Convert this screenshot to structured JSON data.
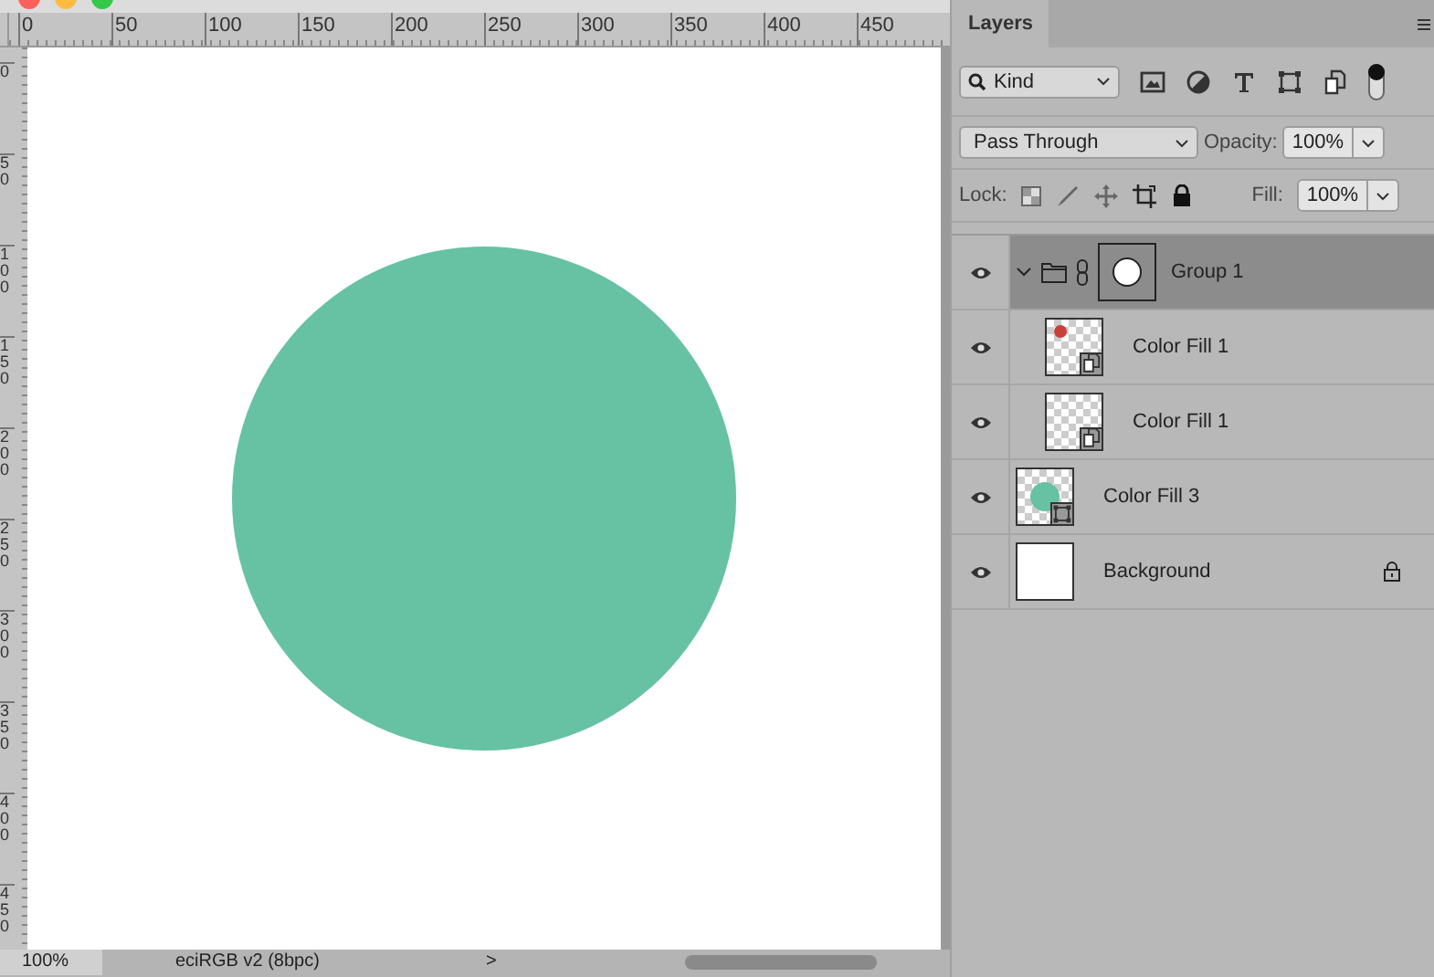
{
  "rulers": {
    "horizontal": [
      "0",
      "50",
      "100",
      "150",
      "200",
      "250",
      "300",
      "350",
      "400",
      "450"
    ],
    "vertical": [
      "0",
      "50",
      "100",
      "150",
      "200",
      "250",
      "300",
      "350",
      "400",
      "450"
    ]
  },
  "canvas": {
    "color": "#66c2a2"
  },
  "status_bar": {
    "zoom": "100%",
    "profile": "eciRGB v2 (8bpc)",
    "arrow": ">"
  },
  "layers_panel": {
    "tab": "Layers",
    "filter": {
      "value": "Kind",
      "toggle_on": true
    },
    "blend_mode": "Pass Through",
    "opacity_label": "Opacity:",
    "opacity": "100%",
    "lock_label": "Lock:",
    "fill_label": "Fill:",
    "fill": "100%",
    "layers": [
      {
        "name": "Group 1",
        "kind": "group",
        "visible": true,
        "selected": true,
        "expanded": true,
        "children": [
          {
            "name": "Color Fill 1",
            "kind": "smart",
            "visible": true,
            "selected": false,
            "color": "#c8403a"
          },
          {
            "name": "Color Fill 1",
            "kind": "smart",
            "visible": true,
            "selected": false
          }
        ]
      },
      {
        "name": "Color Fill 3",
        "kind": "shape",
        "visible": true,
        "selected": false,
        "color": "#66c2a2"
      },
      {
        "name": "Background",
        "kind": "pixel",
        "visible": true,
        "selected": false,
        "locked": true
      }
    ]
  }
}
